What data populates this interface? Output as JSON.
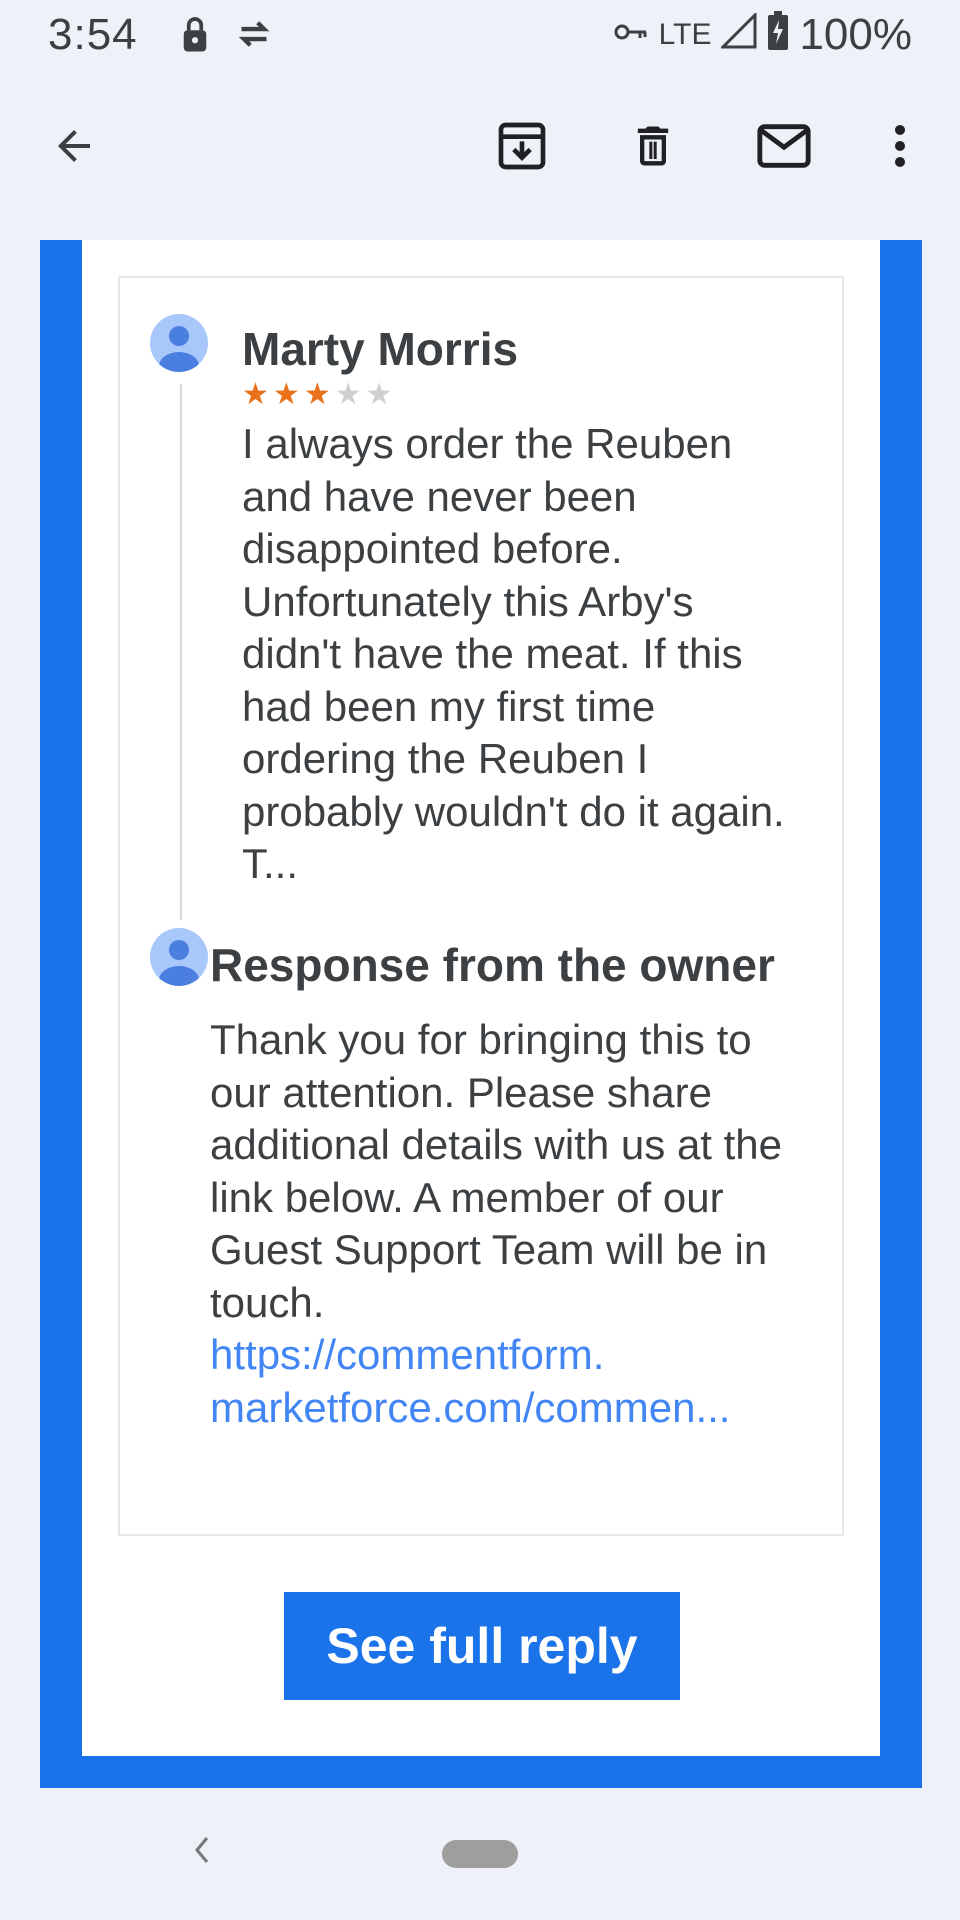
{
  "status_bar": {
    "time": "3:54",
    "network": "LTE",
    "battery": "100%",
    "icons": [
      "lock-icon",
      "sync-icon",
      "vpn-key-icon",
      "signal-icon",
      "battery-charging-icon"
    ]
  },
  "toolbar": {
    "back": "back-arrow-icon",
    "actions": [
      "archive-icon",
      "delete-icon",
      "mail-icon",
      "more-vert-icon"
    ]
  },
  "review": {
    "reviewer_name": "Marty Morris",
    "rating": 3,
    "max_rating": 5,
    "text": "I always order the Reuben and have never been disappointed before. Unfortunately this Arby's didn't have the meat. If this had been my first time ordering the Reuben I probably wouldn't do it again. T..."
  },
  "response": {
    "title": "Response from the owner",
    "text": "Thank you for bringing this to our attention. Please share additional details with us at the link below. A member of our Guest Support Team will be in touch.",
    "link_line1": "https://commentform.",
    "link_line2": "marketforce.com/commen..."
  },
  "cta": {
    "label": "See full reply"
  },
  "colors": {
    "accent": "#1a73e8",
    "star_filled": "#e8711a",
    "star_empty": "#d0d0d0",
    "link": "#4285f4"
  }
}
